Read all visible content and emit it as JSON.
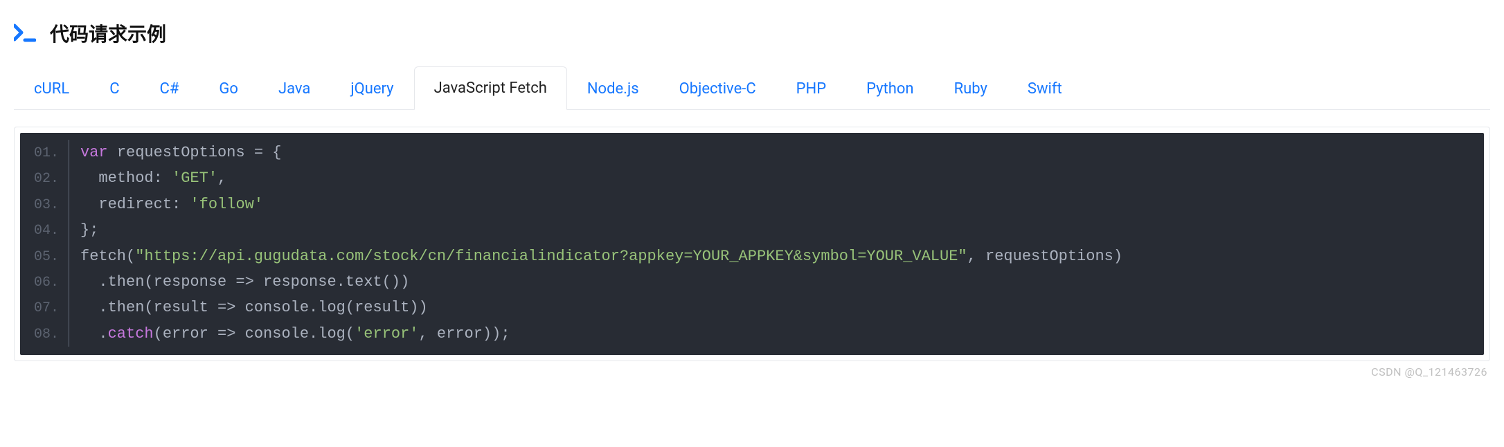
{
  "header": {
    "title": "代码请求示例"
  },
  "tabs": [
    {
      "label": "cURL",
      "active": false
    },
    {
      "label": "C",
      "active": false
    },
    {
      "label": "C#",
      "active": false
    },
    {
      "label": "Go",
      "active": false
    },
    {
      "label": "Java",
      "active": false
    },
    {
      "label": "jQuery",
      "active": false
    },
    {
      "label": "JavaScript Fetch",
      "active": true
    },
    {
      "label": "Node.js",
      "active": false
    },
    {
      "label": "Objective-C",
      "active": false
    },
    {
      "label": "PHP",
      "active": false
    },
    {
      "label": "Python",
      "active": false
    },
    {
      "label": "Ruby",
      "active": false
    },
    {
      "label": "Swift",
      "active": false
    }
  ],
  "code": {
    "lines": [
      {
        "no": "01.",
        "tokens": [
          {
            "t": "var ",
            "c": "kw"
          },
          {
            "t": "requestOptions = {",
            "c": "pln"
          }
        ]
      },
      {
        "no": "02.",
        "tokens": [
          {
            "t": "  method: ",
            "c": "pln"
          },
          {
            "t": "'GET'",
            "c": "str"
          },
          {
            "t": ",",
            "c": "pln"
          }
        ]
      },
      {
        "no": "03.",
        "tokens": [
          {
            "t": "  redirect: ",
            "c": "pln"
          },
          {
            "t": "'follow'",
            "c": "str"
          }
        ]
      },
      {
        "no": "04.",
        "tokens": [
          {
            "t": "};",
            "c": "pln"
          }
        ]
      },
      {
        "no": "05.",
        "tokens": [
          {
            "t": "fetch(",
            "c": "pln"
          },
          {
            "t": "\"https://api.gugudata.com/stock/cn/financialindicator?appkey=YOUR_APPKEY&symbol=YOUR_VALUE\"",
            "c": "str"
          },
          {
            "t": ", requestOptions)",
            "c": "pln"
          }
        ]
      },
      {
        "no": "06.",
        "tokens": [
          {
            "t": "  .then(response => response.text())",
            "c": "pln"
          }
        ]
      },
      {
        "no": "07.",
        "tokens": [
          {
            "t": "  .then(result => console.log(result))",
            "c": "pln"
          }
        ]
      },
      {
        "no": "08.",
        "tokens": [
          {
            "t": "  .",
            "c": "pln"
          },
          {
            "t": "catch",
            "c": "kw"
          },
          {
            "t": "(error => console.log(",
            "c": "pln"
          },
          {
            "t": "'error'",
            "c": "str"
          },
          {
            "t": ", error));",
            "c": "pln"
          }
        ]
      }
    ]
  },
  "watermark": "CSDN @Q_121463726"
}
